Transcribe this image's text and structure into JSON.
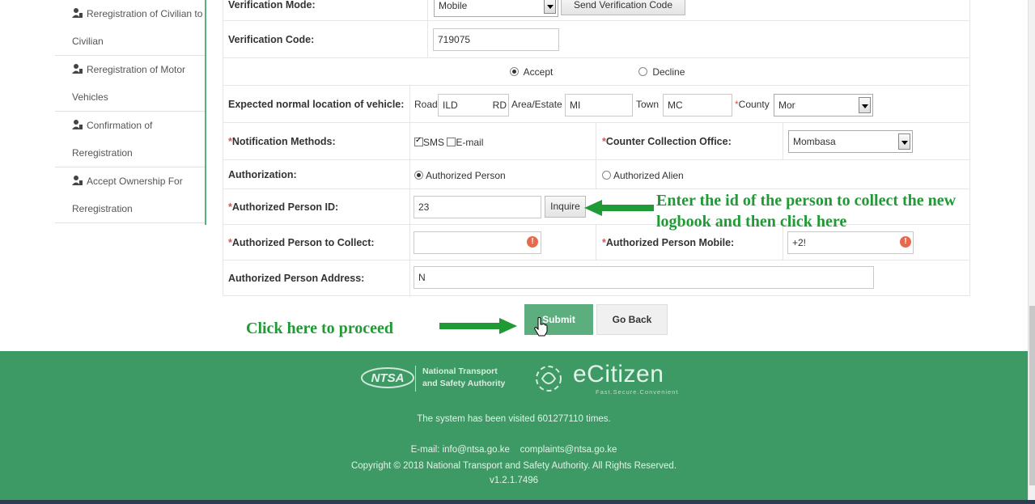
{
  "sidebar": {
    "items": [
      {
        "line1": "Reregistration of Civilian to",
        "line2": "Civilian"
      },
      {
        "line1": "Reregistration of Motor",
        "line2": "Vehicles"
      },
      {
        "line1": "Confirmation of",
        "line2": "Reregistration"
      },
      {
        "line1": "Accept Ownership For",
        "line2": "Reregistration"
      }
    ]
  },
  "form": {
    "verification_mode": {
      "label": "Verification Mode:",
      "value": "Mobile",
      "button": "Send Verification Code"
    },
    "verification_code": {
      "label": "Verification Code:",
      "value": "719075"
    },
    "consent": {
      "accept": "Accept",
      "decline": "Decline"
    },
    "location": {
      "label": "Expected normal location of vehicle:",
      "road_label": "Road",
      "road_value": "ILD",
      "road_suffix": "RD",
      "estate_label": "Area/Estate",
      "estate_value": "MI",
      "town_label": "Town",
      "town_value": "MC",
      "county_label": "County",
      "county_value": "Mor"
    },
    "notification": {
      "label": "Notification Methods:",
      "sms": "SMS",
      "email": "E-mail"
    },
    "collection_office": {
      "label": "Counter Collection Office:",
      "value": "Mombasa"
    },
    "authorization": {
      "label": "Authorization:",
      "person": "Authorized Person",
      "alien": "Authorized Alien"
    },
    "person_id": {
      "label": "Authorized Person ID:",
      "value": "23",
      "button": "Inquire"
    },
    "person_collect": {
      "label": "Authorized Person to Collect:",
      "value": ""
    },
    "person_mobile": {
      "label": "Authorized Person Mobile:",
      "value": "+2!"
    },
    "person_address": {
      "label": "Authorized Person Address:",
      "value": "N"
    }
  },
  "annotations": {
    "inquire_note_line1": "Enter the id of the person to collect the new",
    "inquire_note_line2": "logbook and then click here",
    "proceed_note": "Click here to proceed"
  },
  "actions": {
    "submit": "Submit",
    "go_back": "Go Back"
  },
  "footer": {
    "ntsa_line1": "National Transport",
    "ntsa_line2": "and Safety Authority",
    "ntsa_logo": "NTSA",
    "ecitizen": "eCitizen",
    "ecitizen_tagline": "Fast.Secure.Convenient",
    "visits": "The system has been visited 601277110 times.",
    "email_label": "E-mail:",
    "email_info": "info@ntsa.go.ke",
    "email_complaints": "complaints@ntsa.go.ke",
    "copyright": "Copyright © 2018 National Transport and Safety Authority. All Rights Reserved.",
    "version": "v1.2.1.7496"
  },
  "colors": {
    "brand_green": "#3d9a64",
    "button_green": "#5cae7e",
    "annotation_green": "#1f9a34",
    "required_red": "#d9534f"
  }
}
